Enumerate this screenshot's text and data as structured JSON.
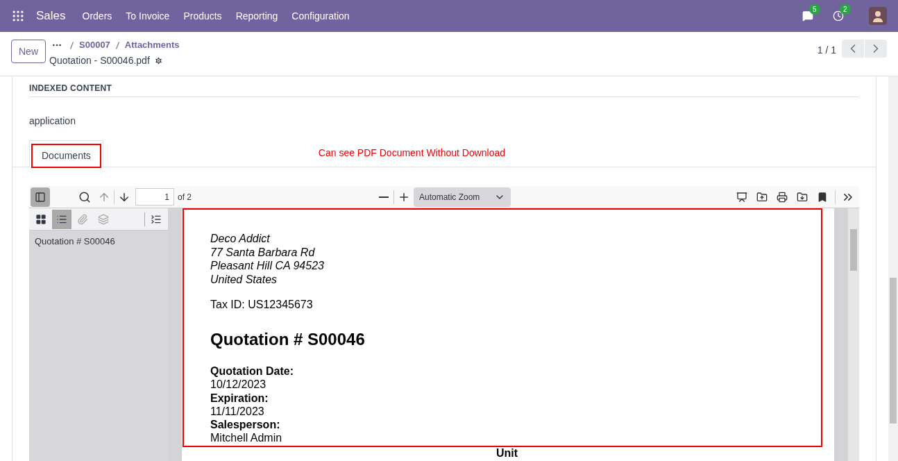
{
  "navbar": {
    "app": "Sales",
    "menu": [
      "Orders",
      "To Invoice",
      "Products",
      "Reporting",
      "Configuration"
    ],
    "messages_badge": "5",
    "activities_badge": "2"
  },
  "control_panel": {
    "new_button": "New",
    "breadcrumbs": [
      "S00007",
      "Attachments"
    ],
    "record_title": "Quotation - S00046.pdf",
    "pager": "1 / 1"
  },
  "form": {
    "section_title": "INDEXED CONTENT",
    "indexed_value": "application",
    "tabs": [
      {
        "label": "Documents",
        "selected": true
      }
    ],
    "annotation": "Can see PDF Document Without Download"
  },
  "pdf_viewer": {
    "page_number": "1",
    "page_count": "of 2",
    "zoom": "Automatic Zoom",
    "outline": [
      "Quotation # S00046"
    ],
    "page": {
      "address": [
        "Deco Addict",
        "77 Santa Barbara Rd",
        "Pleasant Hill CA 94523",
        "United States"
      ],
      "tax_id": "Tax ID: US12345673",
      "title": "Quotation # S00046",
      "fields": [
        {
          "label": "Quotation Date:",
          "value": "10/12/2023"
        },
        {
          "label": "Expiration:",
          "value": "11/11/2023"
        },
        {
          "label": "Salesperson:",
          "value": "Mitchell Admin"
        }
      ],
      "next_heading": "Unit"
    }
  }
}
